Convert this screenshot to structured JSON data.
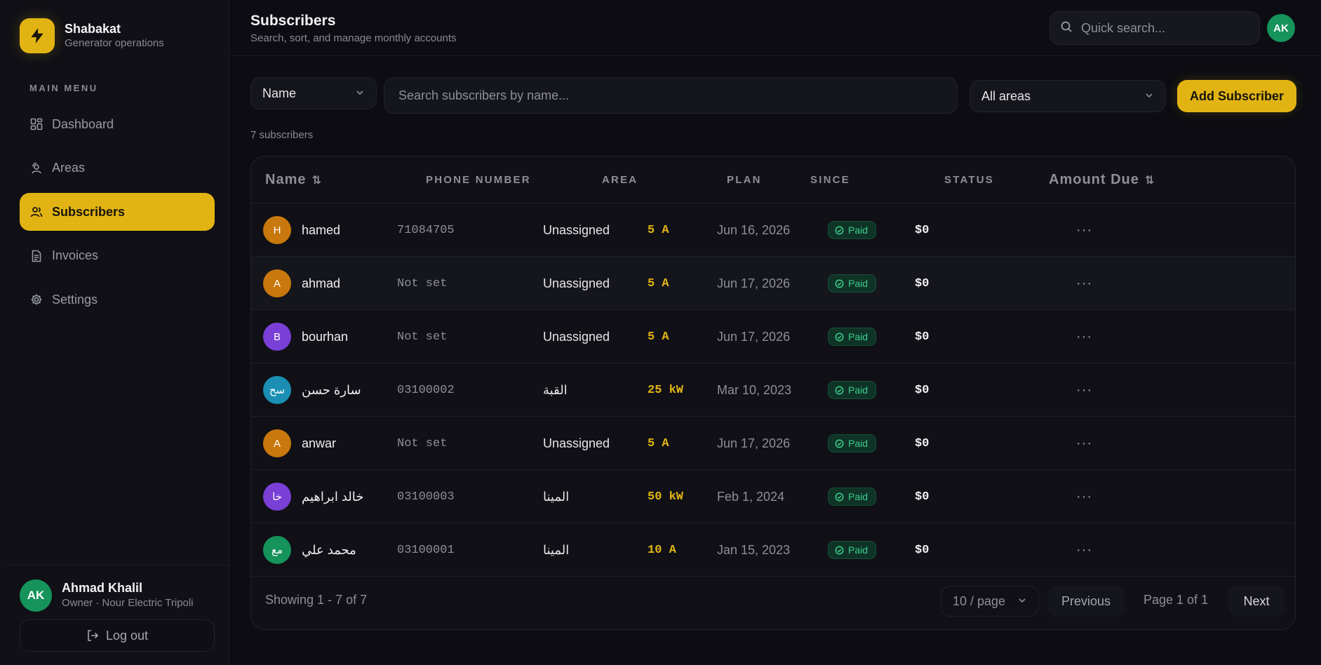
{
  "brand": {
    "name": "Shabakat",
    "subtitle": "Generator operations",
    "accent": "#e2b413"
  },
  "sidebar": {
    "heading": "MAIN MENU",
    "items": [
      {
        "label": "Dashboard",
        "icon": "dashboard-icon",
        "active": false
      },
      {
        "label": "Areas",
        "icon": "map-pin-icon",
        "active": false
      },
      {
        "label": "Subscribers",
        "icon": "users-icon",
        "active": true
      },
      {
        "label": "Invoices",
        "icon": "document-icon",
        "active": false
      },
      {
        "label": "Settings",
        "icon": "gear-icon",
        "active": false
      }
    ],
    "user": {
      "initials": "AK",
      "name": "Ahmad Khalil",
      "role": "Owner · Nour Electric Tripoli"
    },
    "logout_label": "Log out"
  },
  "header": {
    "title": "Subscribers",
    "subtitle": "Search, sort, and manage monthly accounts",
    "quick_search_placeholder": "Quick search...",
    "avatar_initials": "AK"
  },
  "filters": {
    "field_select": "Name",
    "search_placeholder": "Search subscribers by name...",
    "area_select": "All areas",
    "add_label": "Add Subscriber"
  },
  "count_label": "7 subscribers",
  "table": {
    "columns": {
      "name": "Name",
      "phone": "PHONE NUMBER",
      "area": "AREA",
      "plan": "PLAN",
      "since": "SINCE",
      "status": "STATUS",
      "due": "Amount Due"
    },
    "rows": [
      {
        "initials": "H",
        "avatar_color": "#c8780c",
        "name": "hamed",
        "phone": "71084705",
        "area": "Unassigned",
        "plan": "5 A",
        "since": "Jun 16, 2026",
        "status": "Paid",
        "due": "$0"
      },
      {
        "initials": "A",
        "avatar_color": "#c8780c",
        "name": "ahmad",
        "phone": "Not set",
        "area": "Unassigned",
        "plan": "5 A",
        "since": "Jun 17, 2026",
        "status": "Paid",
        "due": "$0"
      },
      {
        "initials": "B",
        "avatar_color": "#7a3fd6",
        "name": "bourhan",
        "phone": "Not set",
        "area": "Unassigned",
        "plan": "5 A",
        "since": "Jun 17, 2026",
        "status": "Paid",
        "due": "$0"
      },
      {
        "initials": "سح",
        "avatar_color": "#1a8fb3",
        "name": "سارة حسن",
        "phone": "03100002",
        "area": "القبة",
        "plan": "25 kW",
        "since": "Mar 10, 2023",
        "status": "Paid",
        "due": "$0"
      },
      {
        "initials": "A",
        "avatar_color": "#c8780c",
        "name": "anwar",
        "phone": "Not set",
        "area": "Unassigned",
        "plan": "5 A",
        "since": "Jun 17, 2026",
        "status": "Paid",
        "due": "$0"
      },
      {
        "initials": "خا",
        "avatar_color": "#7a3fd6",
        "name": "خالد ابراهيم",
        "phone": "03100003",
        "area": "المينا",
        "plan": "50 kW",
        "since": "Feb 1, 2024",
        "status": "Paid",
        "due": "$0"
      },
      {
        "initials": "مع",
        "avatar_color": "#15935b",
        "name": "محمد علي",
        "phone": "03100001",
        "area": "المينا",
        "plan": "10 A",
        "since": "Jan 15, 2023",
        "status": "Paid",
        "due": "$0"
      }
    ]
  },
  "pagination": {
    "showing": "Showing 1 - 7 of 7",
    "per_page": "10 / page",
    "previous": "Previous",
    "page_info": "Page 1 of 1",
    "next": "Next"
  }
}
